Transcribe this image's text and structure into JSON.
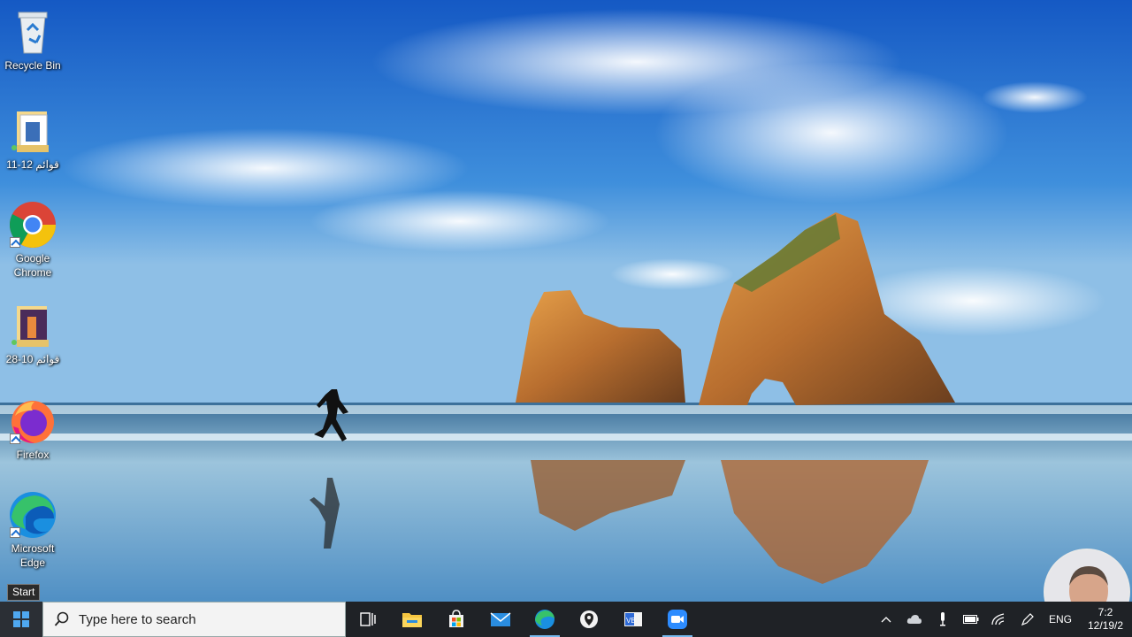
{
  "desktop": {
    "icons": [
      {
        "label": "Recycle Bin",
        "icon": "recycle-bin-icon"
      },
      {
        "label": "قوائم 12-11",
        "icon": "folder-icon"
      },
      {
        "label": "Google Chrome",
        "icon": "chrome-icon"
      },
      {
        "label": "قوائم 10-28",
        "icon": "folder-icon"
      },
      {
        "label": "Firefox",
        "icon": "firefox-icon"
      },
      {
        "label": "Microsoft Edge",
        "icon": "edge-icon"
      }
    ]
  },
  "tooltip": {
    "text": "Start"
  },
  "taskbar": {
    "search": {
      "placeholder": "Type here to search"
    },
    "apps": [
      "task-view-icon",
      "file-explorer-icon",
      "store-icon",
      "mail-icon",
      "edge-icon",
      "maps-icon",
      "vs-icon",
      "zoom-icon"
    ],
    "tray": {
      "language": "ENG",
      "time": "7:2",
      "date": "12/19/2"
    }
  },
  "colors": {
    "taskbar": "#1f2226",
    "sky_top": "#1a66c9",
    "sea": "#5e9ac0"
  }
}
